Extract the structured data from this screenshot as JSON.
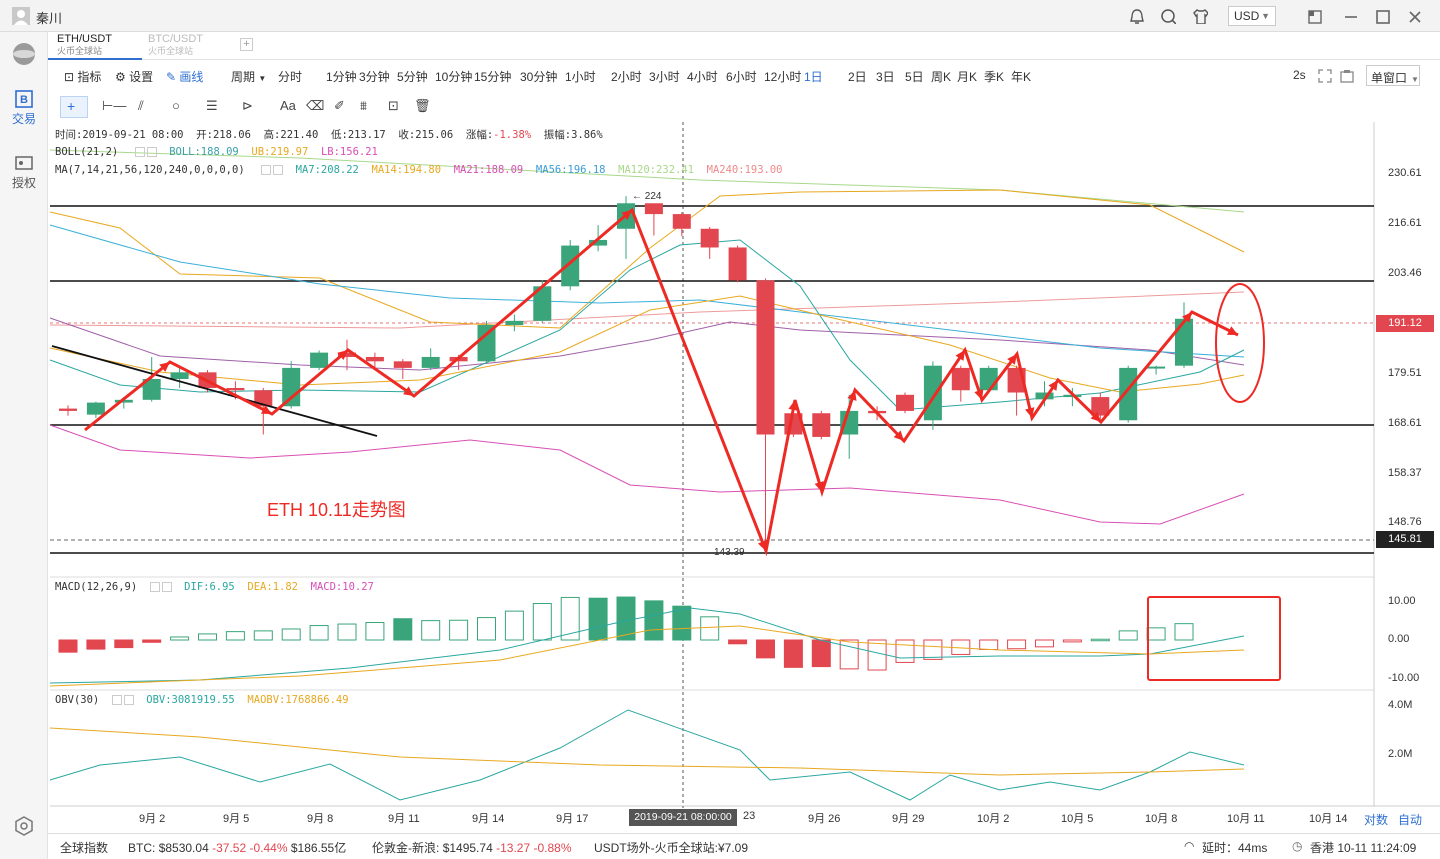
{
  "window": {
    "user": "秦川",
    "currency": "USD"
  },
  "tabs": [
    {
      "pair": "ETH/USDT",
      "exchange": "火币全球站"
    },
    {
      "pair": "BTC/USDT",
      "exchange": "火币全球站"
    }
  ],
  "tab_add": "+",
  "sidebar": {
    "trade": "交易",
    "auth": "授权"
  },
  "toolbar": {
    "indicator": "指标",
    "settings": "设置",
    "draw": "画线",
    "period": "周期",
    "intervals": [
      "分时",
      "1分钟",
      "3分钟",
      "5分钟",
      "10分钟",
      "15分钟",
      "30分钟",
      "1小时",
      "2小时",
      "3小时",
      "4小时",
      "6小时",
      "12小时",
      "1日",
      "2日",
      "3日",
      "5日",
      "周K",
      "月K",
      "季K",
      "年K"
    ],
    "active_interval": "1日",
    "refresh": "2s",
    "window_mode": "单窗口"
  },
  "drawtools": {
    "text_tool": "Aa"
  },
  "info_lines": {
    "ohlc": {
      "time_label": "时间:",
      "time": "2019-09-21 08:00",
      "open_label": "开:",
      "open": "218.06",
      "high_label": "高:",
      "high": "221.40",
      "low_label": "低:",
      "low": "213.17",
      "close_label": "收:",
      "close": "215.06",
      "chg_label": "涨幅:",
      "chg": "-1.38%",
      "amp_label": "振幅:",
      "amp": "3.86%"
    },
    "boll": {
      "name": "BOLL(21,2)",
      "boll": "BOLL:188.09",
      "ub": "UB:219.97",
      "lb": "LB:156.21"
    },
    "ma": {
      "name": "MA(7,14,21,56,120,240,0,0,0,0)",
      "ma7": "MA7:208.22",
      "ma14": "MA14:194.80",
      "ma21": "MA21:188.09",
      "ma56": "MA56:196.18",
      "ma120": "MA120:232.41",
      "ma240": "MA240:193.00"
    },
    "macd": {
      "name": "MACD(12,26,9)",
      "dif": "DIF:6.95",
      "dea": "DEA:1.82",
      "macd": "MACD:10.27"
    },
    "obv": {
      "name": "OBV(30)",
      "obv": "OBV:3081919.55",
      "maobv": "MAOBV:1768866.49"
    }
  },
  "annotations": {
    "title": "ETH  10.11走势图",
    "high_marker": "← 224",
    "low_marker": "143.39"
  },
  "y_axis": {
    "price_ticks": [
      "230.61",
      "216.61",
      "203.46",
      "191.12",
      "179.51",
      "168.61",
      "158.37",
      "148.76",
      "145.81"
    ],
    "current_price": "191.12",
    "level_price": "145.81",
    "macd_ticks": [
      "10.00",
      "0.00",
      "-10.00"
    ],
    "obv_ticks": [
      "4.0M",
      "2.0M"
    ]
  },
  "x_axis": {
    "labels": [
      "9月 2",
      "9月 5",
      "9月 8",
      "9月 11",
      "9月 14",
      "9月 17",
      "23",
      "9月 26",
      "9月 29",
      "10月 2",
      "10月 5",
      "10月 8",
      "10月 11",
      "10月 14"
    ],
    "crosshair": "2019-09-21 08:00:00",
    "log_scale": "对数",
    "auto_scale": "自动"
  },
  "status": {
    "global_index": "全球指数",
    "btc_label": "BTC:",
    "btc_price": "$8530.04",
    "btc_chg": "-37.52",
    "btc_pct": "-0.44%",
    "btc_vol": "$186.55亿",
    "gold_label": "伦敦金-新浪:",
    "gold_price": "$1495.74",
    "gold_chg": "-13.27",
    "gold_pct": "-0.88%",
    "usdt_label": "USDT场外-火币全球站:",
    "usdt_price": "¥7.09",
    "latency": "延时：44ms",
    "clock": "香港 10-11 11:24:09"
  },
  "colors": {
    "up": "#3aa57a",
    "down": "#e2464f",
    "accent": "#2f6fd0",
    "annot": "#ee2a24"
  },
  "chart_data": {
    "type": "candlestick",
    "title": "ETH  10.11走势图",
    "x": [
      "9月1",
      "9月2",
      "9月3",
      "9月4",
      "9月5",
      "9月6",
      "9月7",
      "9月8",
      "9月9",
      "9月10",
      "9月11",
      "9月12",
      "9月13",
      "9月14",
      "9月15",
      "9月16",
      "9月17",
      "9月18",
      "9月19",
      "9月20",
      "9月21",
      "9月22",
      "9月23",
      "9月24",
      "9月25",
      "9月26",
      "9月27",
      "9月28",
      "9月29",
      "9月30",
      "10月1",
      "10月2",
      "10月3",
      "10月4",
      "10月5",
      "10月6",
      "10月7",
      "10月8",
      "10月9",
      "10月10",
      "10月11"
    ],
    "candles": [
      [
        171.5,
        172.2,
        170.0,
        171.0
      ],
      [
        170.2,
        173.0,
        169.5,
        172.8
      ],
      [
        172.8,
        174.0,
        171.5,
        173.4
      ],
      [
        173.4,
        183.0,
        173.0,
        178.0
      ],
      [
        178.0,
        181.0,
        176.0,
        179.5
      ],
      [
        179.5,
        180.0,
        175.0,
        176.0
      ],
      [
        176.0,
        177.5,
        173.5,
        175.5
      ],
      [
        175.5,
        176.0,
        166.0,
        172.0
      ],
      [
        172.0,
        182.0,
        171.5,
        180.5
      ],
      [
        180.5,
        184.5,
        180.0,
        184.0
      ],
      [
        184.0,
        187.0,
        180.0,
        183.0
      ],
      [
        183.0,
        184.0,
        180.5,
        182.0
      ],
      [
        182.0,
        182.5,
        178.0,
        180.5
      ],
      [
        180.5,
        185.0,
        180.0,
        183.0
      ],
      [
        183.0,
        183.5,
        180.0,
        182.0
      ],
      [
        182.0,
        191.5,
        181.5,
        190.5
      ],
      [
        190.5,
        193.0,
        189.0,
        191.5
      ],
      [
        191.5,
        201.5,
        191.0,
        200.0
      ],
      [
        200.0,
        212.0,
        199.0,
        210.5
      ],
      [
        210.5,
        216.0,
        209.0,
        212.0
      ],
      [
        215.0,
        224.0,
        207.0,
        222.0
      ],
      [
        222.0,
        221.4,
        213.2,
        219.0
      ],
      [
        219.0,
        219.5,
        213.0,
        215.0
      ],
      [
        215.0,
        215.5,
        207.0,
        210.0
      ],
      [
        210.0,
        210.5,
        201.0,
        201.5
      ],
      [
        201.5,
        202.0,
        143.4,
        166.0
      ],
      [
        170.5,
        173.0,
        165.5,
        166.0
      ],
      [
        170.5,
        171.0,
        165.0,
        165.5
      ],
      [
        166.0,
        174.5,
        161.0,
        171.0
      ],
      [
        171.0,
        172.0,
        169.0,
        170.5
      ],
      [
        174.5,
        175.0,
        170.5,
        171.0
      ],
      [
        169.0,
        182.0,
        167.0,
        181.0
      ],
      [
        180.5,
        181.0,
        173.0,
        175.5
      ],
      [
        175.5,
        181.0,
        175.0,
        180.5
      ],
      [
        180.5,
        181.0,
        170.0,
        175.0
      ],
      [
        173.5,
        177.5,
        172.0,
        175.0
      ],
      [
        174.0,
        176.0,
        172.0,
        174.5
      ],
      [
        174.0,
        175.0,
        168.5,
        170.0
      ],
      [
        169.0,
        181.0,
        168.5,
        180.5
      ],
      [
        180.5,
        181.0,
        179.0,
        180.8
      ],
      [
        181.0,
        196.0,
        180.5,
        192.0
      ],
      [
        192.0,
        193.0,
        189.5,
        190.0
      ],
      [
        190.5,
        191.5,
        189.0,
        191.12
      ]
    ],
    "macd_hist": [
      -3.2,
      -2.4,
      -2.0,
      -0.6,
      0.8,
      1.6,
      2.2,
      2.4,
      2.9,
      3.8,
      4.2,
      4.6,
      5.6,
      5.1,
      5.2,
      5.9,
      7.6,
      9.6,
      11.2,
      11.0,
      11.3,
      10.3,
      8.9,
      6.1,
      -1.0,
      -4.7,
      -7.2,
      -7.0,
      -7.6,
      -7.9,
      -5.9,
      -5.1,
      -3.8,
      -2.5,
      -2.3,
      -1.8,
      -0.5,
      0.2,
      2.4,
      3.2,
      4.3
    ],
    "dif_dea": {
      "dif_end": 6.95,
      "dea_end": 1.82
    },
    "obv_end": 3081919.55,
    "maobv_end": 1768866.49,
    "ylim": [
      143.39,
      230.61
    ],
    "log_scale": true
  }
}
